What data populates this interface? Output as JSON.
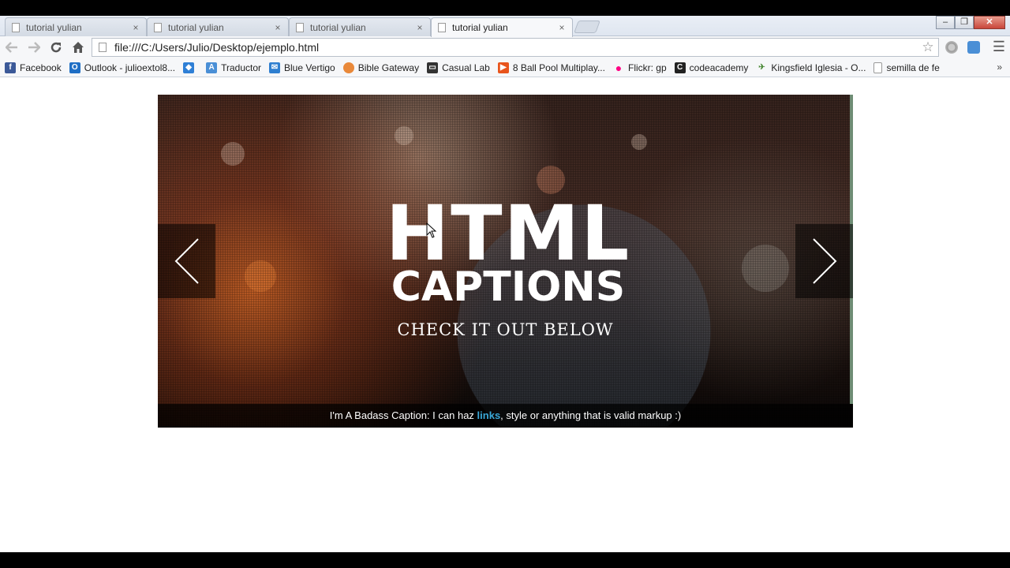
{
  "browser": {
    "tabs": [
      {
        "title": "tutorial yulian",
        "active": false
      },
      {
        "title": "tutorial yulian",
        "active": false
      },
      {
        "title": "tutorial yulian",
        "active": false
      },
      {
        "title": "tutorial yulian",
        "active": true
      }
    ],
    "tab_close_glyph": "×",
    "window_controls": {
      "minimize": "–",
      "maximize": "❐",
      "close": "✕"
    },
    "url": "file:///C:/Users/Julio/Desktop/ejemplo.html",
    "bookmarks": [
      {
        "label": "Facebook",
        "icon": "facebook-icon",
        "color": "#3b5998"
      },
      {
        "label": "Outlook - julioextol8...",
        "icon": "outlook-icon",
        "color": "#1f6fc5"
      },
      {
        "label": "",
        "icon": "dropbox-icon",
        "color": "#2e7fd6"
      },
      {
        "label": "Traductor",
        "icon": "translate-icon",
        "color": "#4a8fd6"
      },
      {
        "label": "Blue Vertigo",
        "icon": "mail-icon",
        "color": "#2f7fd0"
      },
      {
        "label": "Bible Gateway",
        "icon": "bible-gateway-icon",
        "color": "#e9893a"
      },
      {
        "label": "Casual Lab",
        "icon": "monitor-icon",
        "color": "#333333"
      },
      {
        "label": "8 Ball Pool Multiplay...",
        "icon": "play-icon",
        "color": "#e8541c"
      },
      {
        "label": "Flickr: gp",
        "icon": "flickr-icon",
        "color": "#ff0084"
      },
      {
        "label": "codeacademy",
        "icon": "codecademy-icon",
        "color": "#222222"
      },
      {
        "label": "Kingsfield Iglesia - O...",
        "icon": "bird-icon",
        "color": "#4d8b3a"
      },
      {
        "label": "semilla de fe",
        "icon": "page-icon",
        "color": "#ffffff"
      }
    ],
    "bookmarks_more": "»"
  },
  "slider": {
    "headline_line1": "HTML",
    "headline_line2": "CAPTIONS",
    "subheading": "CHECK IT OUT BELOW",
    "caption_before": "I'm A Badass Caption: I can haz ",
    "caption_link": "links",
    "caption_after": ", style or anything that is valid markup :)"
  }
}
